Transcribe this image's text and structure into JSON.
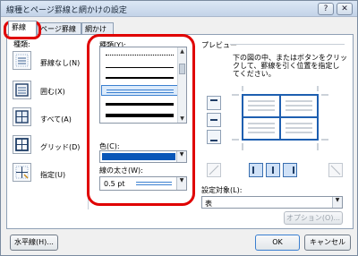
{
  "window": {
    "title": "線種とページ罫線と網かけの設定",
    "help_label": "?",
    "close_label": "✕"
  },
  "tabs": [
    {
      "label": "罫線",
      "active": true
    },
    {
      "label": "ページ罫線",
      "active": false
    },
    {
      "label": "網かけ",
      "active": false
    }
  ],
  "settings": {
    "header": "種類:",
    "items": [
      {
        "label": "罫線なし(N)",
        "icon": "no-border-icon"
      },
      {
        "label": "囲む(X)",
        "icon": "box-border-icon"
      },
      {
        "label": "すべて(A)",
        "icon": "all-borders-icon"
      },
      {
        "label": "グリッド(D)",
        "icon": "grid-border-icon"
      },
      {
        "label": "指定(U)",
        "icon": "custom-border-icon"
      }
    ]
  },
  "style": {
    "label": "種類(Y):",
    "color_label": "色(C):",
    "color_value": "#0a57b8",
    "width_label": "線の太さ(W):",
    "width_value": "0.5 pt"
  },
  "preview": {
    "label": "プレビュー",
    "instruction_line1": "下の図の中、またはボタンをクリッ",
    "instruction_line2": "クして、罫線を引く位置を指定し",
    "instruction_line3": "てください。",
    "apply_label": "設定対象(L):",
    "apply_value": "表",
    "options_label": "オプション(O)..."
  },
  "footer": {
    "horizontal_label": "水平線(H)...",
    "ok_label": "OK",
    "cancel_label": "キャンセル"
  },
  "colors": {
    "highlight": "#e00000",
    "accent": "#3a7fd0"
  }
}
